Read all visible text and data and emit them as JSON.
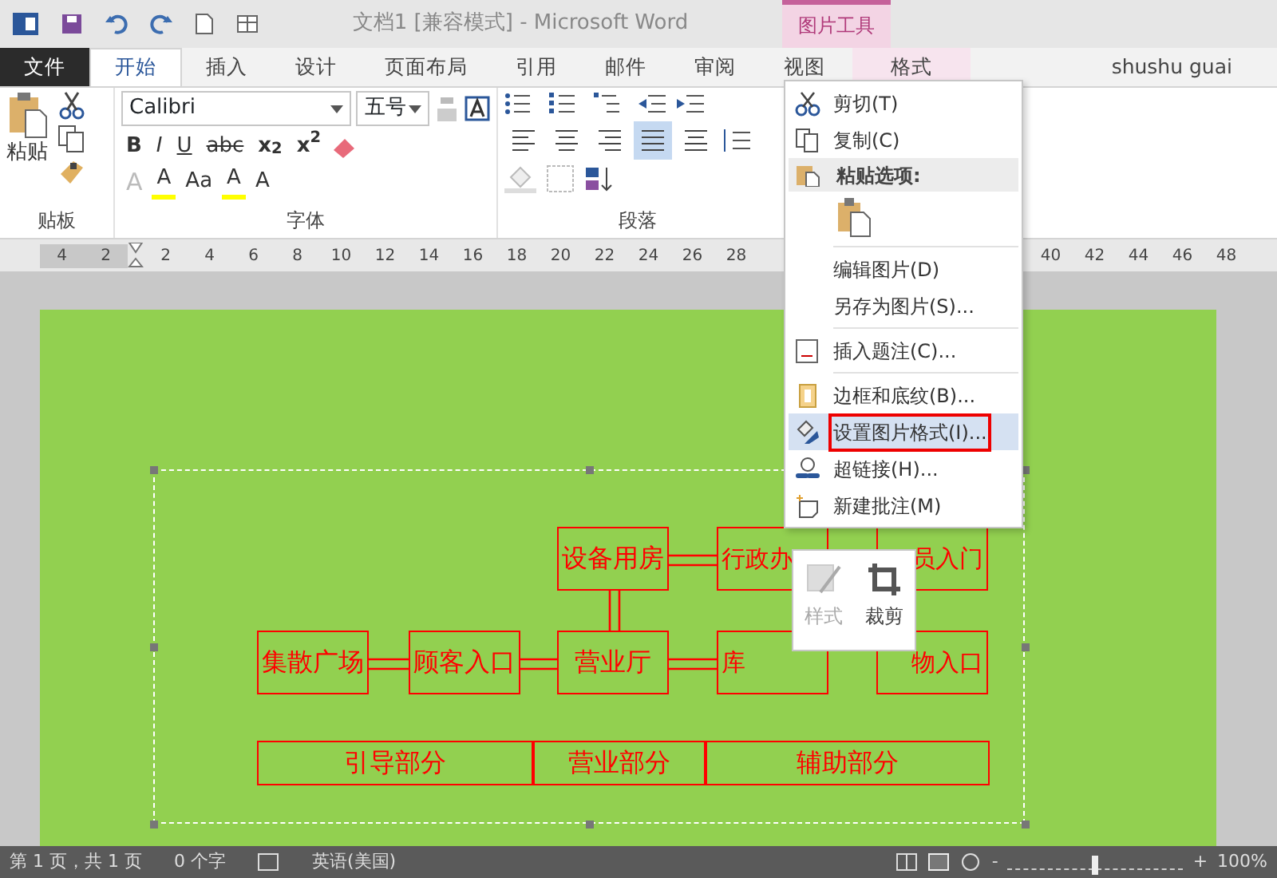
{
  "title_bar": {
    "title": "文档1 [兼容模式] - Microsoft Word",
    "contextual_group": "图片工具"
  },
  "tabs": [
    {
      "label": "文件",
      "kind": "file",
      "selected": false
    },
    {
      "label": "开始",
      "kind": "tab",
      "selected": true
    },
    {
      "label": "插入",
      "kind": "tab",
      "selected": false
    },
    {
      "label": "设计",
      "kind": "tab",
      "selected": false
    },
    {
      "label": "页面布局",
      "kind": "tab",
      "selected": false
    },
    {
      "label": "引用",
      "kind": "tab",
      "selected": false
    },
    {
      "label": "邮件",
      "kind": "tab",
      "selected": false
    },
    {
      "label": "审阅",
      "kind": "tab",
      "selected": false
    },
    {
      "label": "视图",
      "kind": "tab",
      "selected": false
    },
    {
      "label": "格式",
      "kind": "contextual",
      "selected": false
    }
  ],
  "user": "shushu guai",
  "ribbon": {
    "paste_label": "粘贴",
    "font_name": "Calibri",
    "font_size": "五号",
    "font_buttons": [
      "B",
      "I",
      "U",
      "abc",
      "x$_{2}$",
      "x$^{2}$"
    ],
    "font_buttons_2": [
      "A",
      "A",
      "Aa",
      "A",
      "A"
    ],
    "align_buttons": [
      {
        "selected": false
      },
      {
        "selected": false
      },
      {
        "selected": false
      },
      {
        "selected": true
      },
      {
        "selected": false
      }
    ],
    "groups": [
      "贴板",
      "字体",
      "段落"
    ]
  },
  "ruler": {
    "ticks": [
      "4",
      "2",
      "2",
      "4",
      "6",
      "8",
      "10",
      "12",
      "14",
      "16",
      "18",
      "20",
      "22",
      "24",
      "26",
      "28"
    ],
    "right_ticks": [
      "40",
      "42",
      "44",
      "46",
      "48"
    ]
  },
  "diagram": {
    "nodes": [
      {
        "label": "设备用房"
      },
      {
        "label": "行政办"
      },
      {
        "label": "员入门"
      },
      {
        "label": "集散广场"
      },
      {
        "label": "顾客入口"
      },
      {
        "label": "营业厅"
      },
      {
        "label": "库"
      },
      {
        "label": "物入口"
      }
    ],
    "bands": [
      "引导部分",
      "营业部分",
      "辅助部分"
    ]
  },
  "context_menu": {
    "items": [
      {
        "kind": "item",
        "label": "剪切(T)",
        "selected": false
      },
      {
        "kind": "item",
        "label": "复制(C)",
        "selected": false
      },
      {
        "kind": "header",
        "label": "粘贴选项:"
      },
      {
        "kind": "paste-icons"
      },
      {
        "kind": "separator"
      },
      {
        "kind": "item",
        "label": "编辑图片(D)",
        "selected": false
      },
      {
        "kind": "item",
        "label": "另存为图片(S)...",
        "selected": false
      },
      {
        "kind": "separator"
      },
      {
        "kind": "item",
        "label": "插入题注(C)...",
        "selected": false
      },
      {
        "kind": "separator"
      },
      {
        "kind": "item",
        "label": "边框和底纹(B)...",
        "selected": false
      },
      {
        "kind": "item",
        "label": "设置图片格式(I)...",
        "selected": true
      },
      {
        "kind": "item",
        "label": "超链接(H)...",
        "selected": false
      },
      {
        "kind": "item",
        "label": "新建批注(M)",
        "selected": false
      }
    ]
  },
  "mini_toolbar": {
    "buttons": [
      {
        "label": "样式",
        "disabled": true
      },
      {
        "label": "裁剪",
        "disabled": false
      }
    ]
  },
  "status_bar": {
    "items": [
      "第 1 页，共 1 页",
      "0 个字",
      "英语(美国)"
    ],
    "zoom_out": "-",
    "zoom_in": "+",
    "zoom": {
      "level": 0.5
    },
    "zoom_text": "100%"
  }
}
